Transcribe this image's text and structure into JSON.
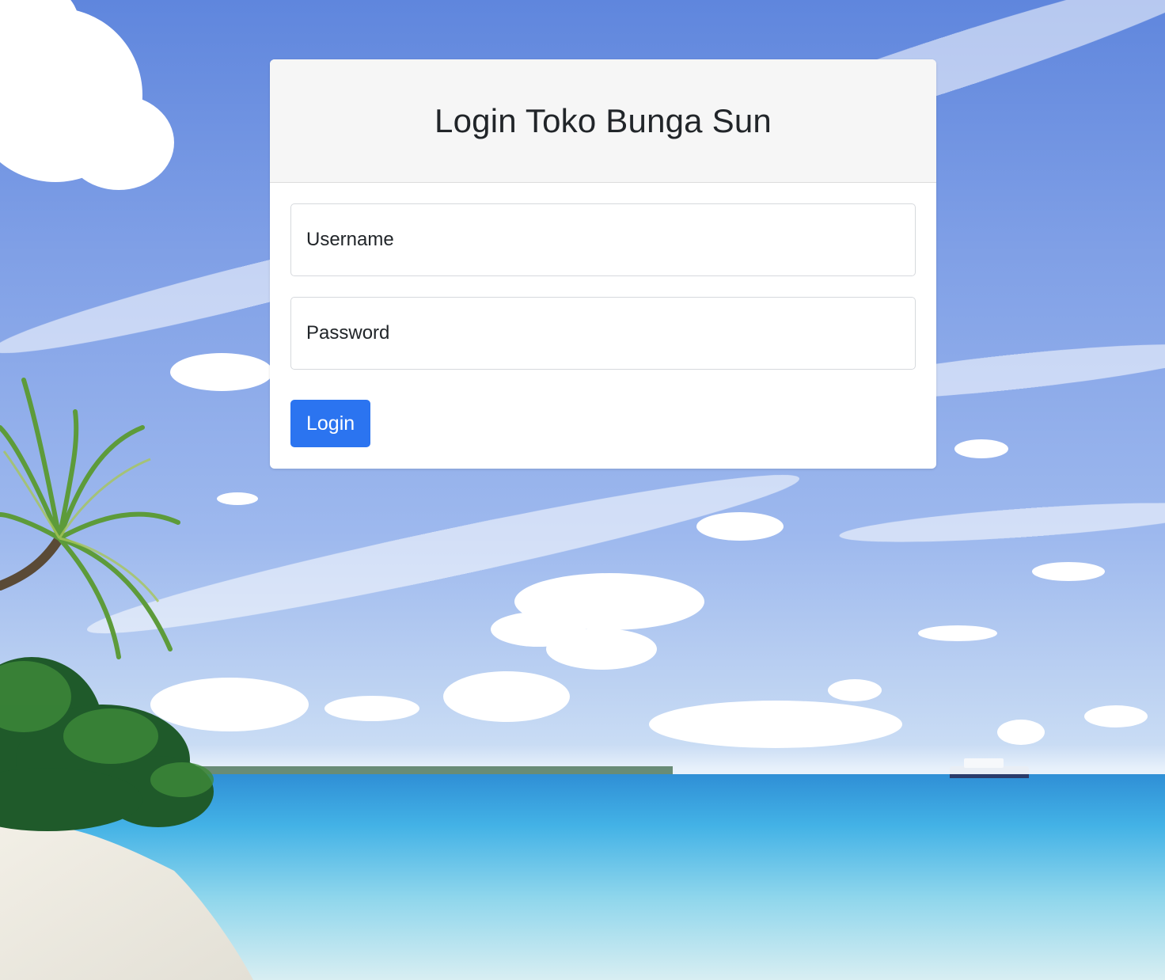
{
  "login": {
    "title": "Login Toko Bunga Sun",
    "username_placeholder": "Username",
    "password_placeholder": "Password",
    "submit_label": "Login"
  },
  "colors": {
    "primary_button": "#2b74f0",
    "header_background": "#f6f6f6",
    "text": "#212529"
  },
  "background": {
    "scene": "tropical-beach-with-palm-tree"
  }
}
